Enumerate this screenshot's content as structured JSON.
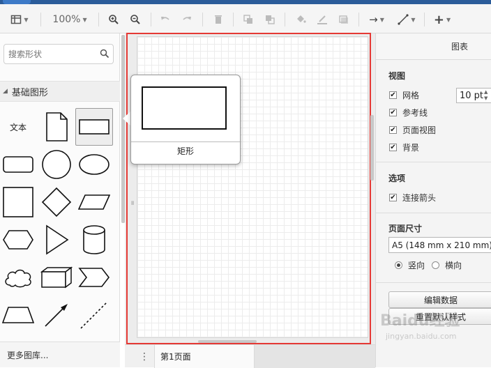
{
  "toolbar": {
    "zoom_label": "100%"
  },
  "sidebar": {
    "search_placeholder": "搜索形状",
    "section_title": "基础图形",
    "text_shape_label": "文本",
    "more_shapes": "更多图库..."
  },
  "tooltip": {
    "shape_name": "矩形"
  },
  "bottom": {
    "page_tab": "第1页面"
  },
  "panel": {
    "title": "图表",
    "view_title": "视图",
    "grid": "网格",
    "grid_size": "10 pt",
    "guides": "参考线",
    "page_view": "页面视图",
    "background": "背景",
    "options_title": "选项",
    "connection_arrows": "连接箭头",
    "page_size_title": "页面尺寸",
    "page_size_value": "A5 (148 mm x 210 mm)",
    "portrait": "竖向",
    "landscape": "横向",
    "edit_data": "编辑数据",
    "reset_style": "重置默认样式"
  },
  "watermark": {
    "brand": "Baidu经验",
    "url": "jingyan.baidu.com"
  },
  "colors": {
    "highlight": "#e53935",
    "header": "#2b5c9a"
  }
}
